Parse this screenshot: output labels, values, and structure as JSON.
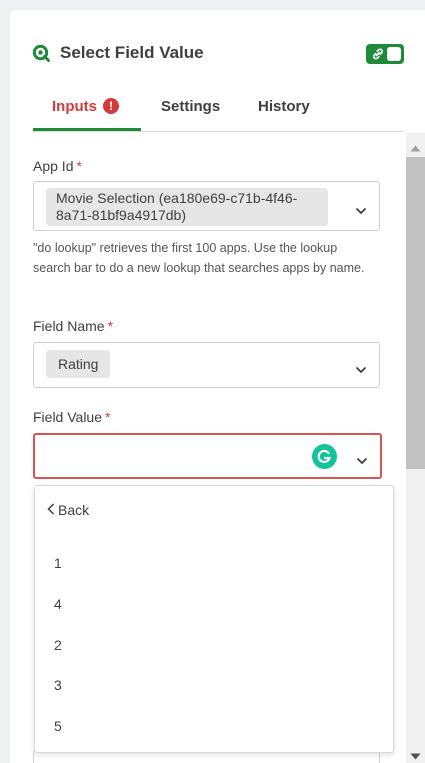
{
  "header": {
    "title": "Select Field Value",
    "logo_icon": "qlik-logo-icon",
    "toggle_icon": "link-icon",
    "accent": "#1e8a3a"
  },
  "tabs": [
    {
      "label": "Inputs",
      "error_badge": "!"
    },
    {
      "label": "Settings"
    },
    {
      "label": "History"
    }
  ],
  "form": {
    "app_id": {
      "label": "App Id",
      "required_mark": "*",
      "value": "Movie Selection (ea180e69-c71b-4f46-8a71-81bf9a4917db)"
    },
    "help_text": "\"do lookup\" retrieves the first 100 apps. Use the lookup search bar to do a new lookup that searches apps by name.",
    "field_name": {
      "label": "Field Name",
      "required_mark": "*",
      "value": "Rating"
    },
    "field_value": {
      "label": "Field Value",
      "required_mark": "*",
      "value": "",
      "error_color": "#d9534f"
    }
  },
  "dropdown": {
    "back_label": "Back",
    "options": [
      "1",
      "4",
      "2",
      "3",
      "5"
    ]
  }
}
